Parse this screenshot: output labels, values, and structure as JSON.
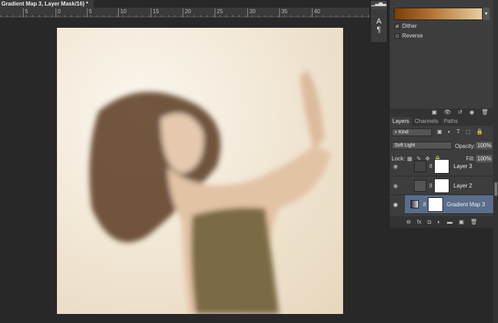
{
  "document": {
    "tab_title": "Gradient Map 3, Layer Mask/16) *"
  },
  "ruler": {
    "labels": [
      "5",
      "0",
      "5",
      "10",
      "15",
      "20",
      "25",
      "30",
      "35",
      "40"
    ]
  },
  "tools": {
    "histogram_icon": "histogram-icon",
    "character": "A",
    "paragraph": "¶"
  },
  "properties": {
    "gradient_colors": [
      "#7a3e08",
      "#b07030",
      "#e8cf9e"
    ],
    "dither_label": "Dither",
    "dither_checked": true,
    "reverse_label": "Reverse",
    "reverse_checked": false,
    "check_glyph": "✓",
    "dropdown_glyph": "▾",
    "footer_icons": [
      "clip-to-layer-icon",
      "view-previous-icon",
      "reset-icon",
      "visibility-icon",
      "delete-icon"
    ],
    "footer_glyphs": [
      "▣",
      "👁",
      "↺",
      "◉",
      "🗑"
    ]
  },
  "layers_panel": {
    "tabs": [
      "Layers",
      "Channels",
      "Paths"
    ],
    "filter_kind": "Kind",
    "blend_mode": "Soft Light",
    "opacity_label": "Opacity:",
    "opacity_value": "100%",
    "lock_label": "Lock:",
    "fill_label": "Fill:",
    "fill_value": "100%",
    "filter_glyphs": [
      "▣",
      "◐",
      "T",
      "⬚",
      "🔒"
    ],
    "lock_glyphs": [
      "▦",
      "✎",
      "✥",
      "🔒"
    ],
    "layers": [
      {
        "name": "Layer 3",
        "selected": false
      },
      {
        "name": "Layer 2",
        "selected": false
      },
      {
        "name": "Gradient Map 3",
        "selected": true
      }
    ],
    "eye_glyph": "◉",
    "chain_glyph": "8",
    "footer_glyphs": [
      "⊖",
      "fx",
      "◘",
      "◐",
      "▬",
      "▣",
      "🗑"
    ]
  }
}
